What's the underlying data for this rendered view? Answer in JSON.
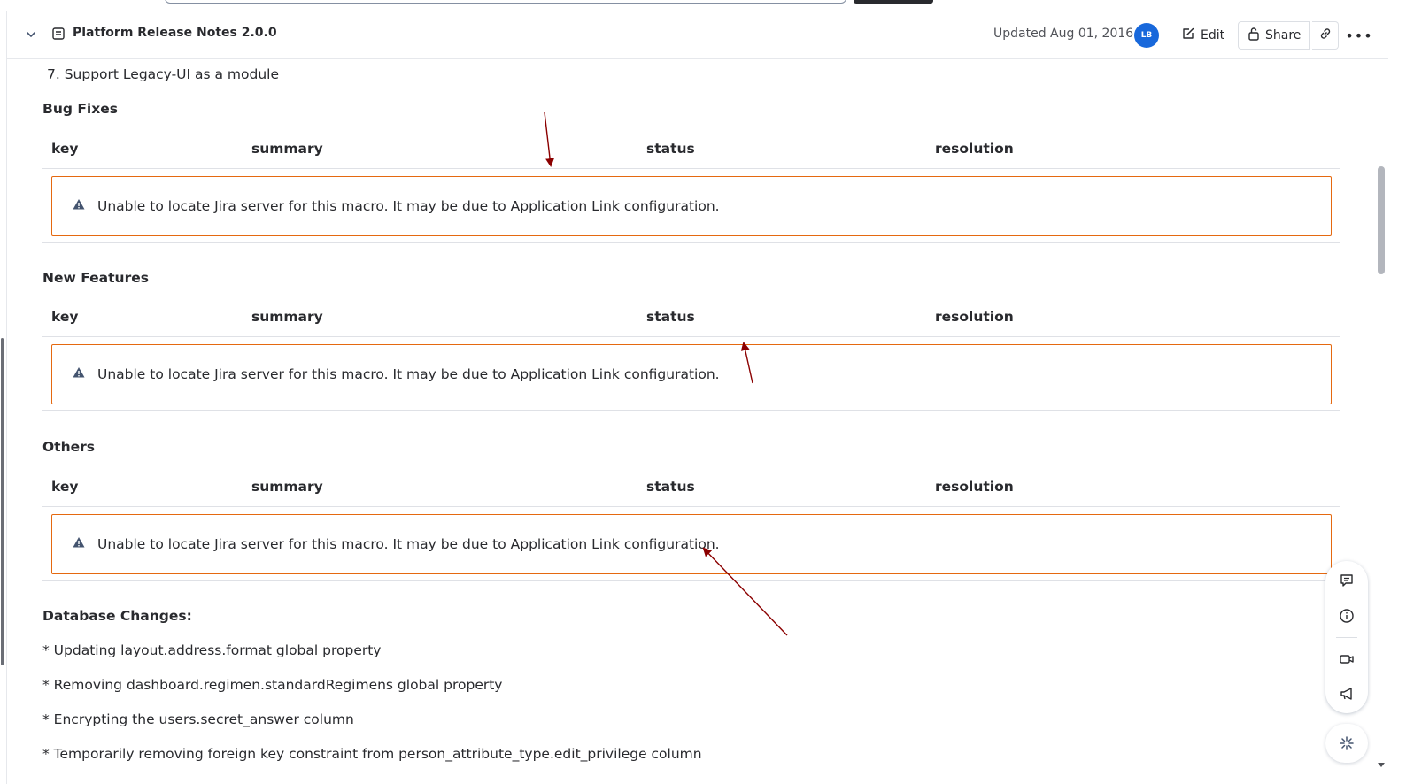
{
  "header": {
    "title": "Platform Release Notes 2.0.0",
    "updated": "Updated Aug 01, 2016",
    "avatar_initials": "LB",
    "edit_label": "Edit",
    "share_label": "Share"
  },
  "content": {
    "list_item": "7. Support Legacy-UI as a module",
    "sections": [
      {
        "heading": "Bug Fixes",
        "columns": [
          "key",
          "summary",
          "status",
          "resolution"
        ],
        "warning": "Unable to locate Jira server for this macro. It may be due to Application Link configuration."
      },
      {
        "heading": "New Features",
        "columns": [
          "key",
          "summary",
          "status",
          "resolution"
        ],
        "warning": "Unable to locate Jira server for this macro. It may be due to Application Link configuration."
      },
      {
        "heading": "Others",
        "columns": [
          "key",
          "summary",
          "status",
          "resolution"
        ],
        "warning": "Unable to locate Jira server for this macro. It may be due to Application Link configuration."
      }
    ],
    "db_heading": "Database Changes:",
    "db_items": [
      "* Updating layout.address.format global property",
      "* Removing dashboard.regimen.standardRegimens global property",
      "* Encrypting the users.secret_answer column",
      "* Temporarily removing foreign key constraint from person_attribute_type.edit_privilege column"
    ]
  },
  "colors": {
    "warning_border": "#e56910",
    "avatar_bg": "#1868db",
    "annotation_arrow": "#8b0000"
  },
  "icons": {
    "collapse": "chevron-down-icon",
    "page": "page-icon",
    "edit": "pencil-icon",
    "share": "lock-icon",
    "link": "link-icon",
    "more": "more-icon",
    "warning": "warning-icon",
    "comment": "comment-icon",
    "info": "info-icon",
    "video": "video-icon",
    "announce": "megaphone-icon",
    "ai": "ai-sparkle-icon"
  }
}
